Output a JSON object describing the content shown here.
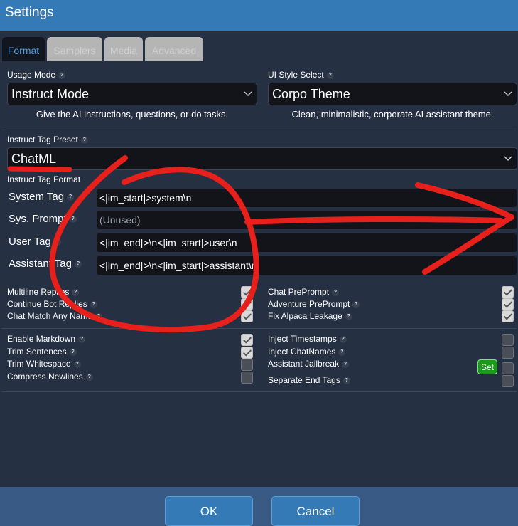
{
  "window": {
    "title": "Settings"
  },
  "tabs": [
    {
      "label": "Format",
      "active": true
    },
    {
      "label": "Samplers",
      "active": false
    },
    {
      "label": "Media",
      "active": false
    },
    {
      "label": "Advanced",
      "active": false
    }
  ],
  "usage_mode": {
    "label": "Usage Mode",
    "value": "Instruct Mode",
    "description": "Give the AI instructions, questions, or do tasks."
  },
  "ui_style": {
    "label": "UI Style Select",
    "value": "Corpo Theme",
    "description": "Clean, minimalistic, corporate AI assistant theme."
  },
  "instruct_preset": {
    "label": "Instruct Tag Preset",
    "value": "ChatML"
  },
  "instruct_format": {
    "label": "Instruct Tag Format",
    "system_tag": {
      "label": "System Tag",
      "value": "<|im_start|>system\\n"
    },
    "sys_prompt": {
      "label": "Sys. Prompt",
      "placeholder": "(Unused)"
    },
    "user_tag": {
      "label": "User Tag",
      "value": "<|im_end|>\\n<|im_start|>user\\n"
    },
    "assistant_tag": {
      "label": "Assistant Tag",
      "value": "<|im_end|>\\n<|im_start|>assistant\\n"
    }
  },
  "options_group1": {
    "left": [
      {
        "label": "Multiline Replies",
        "checked": true
      },
      {
        "label": "Continue Bot Replies",
        "checked": true
      },
      {
        "label": "Chat Match Any Name",
        "checked": true
      }
    ],
    "right": [
      {
        "label": "Chat PrePrompt",
        "checked": true
      },
      {
        "label": "Adventure PrePrompt",
        "checked": true
      },
      {
        "label": "Fix Alpaca Leakage",
        "checked": true
      }
    ]
  },
  "options_group2": {
    "left": [
      {
        "label": "Enable Markdown",
        "checked": true
      },
      {
        "label": "Trim Sentences",
        "checked": true
      },
      {
        "label": "Trim Whitespace",
        "checked": false
      },
      {
        "label": "Compress Newlines",
        "checked": false
      }
    ],
    "right": [
      {
        "label": "Inject Timestamps",
        "checked": false
      },
      {
        "label": "Inject ChatNames",
        "checked": false
      },
      {
        "label": "Assistant Jailbreak",
        "checked": false
      },
      {
        "label": "Separate End Tags",
        "checked": false
      }
    ],
    "set_button": "Set"
  },
  "footer": {
    "ok": "OK",
    "cancel": "Cancel"
  },
  "help_glyph": "?",
  "colors": {
    "accent": "#337ab7",
    "annotation": "#e8201c"
  }
}
